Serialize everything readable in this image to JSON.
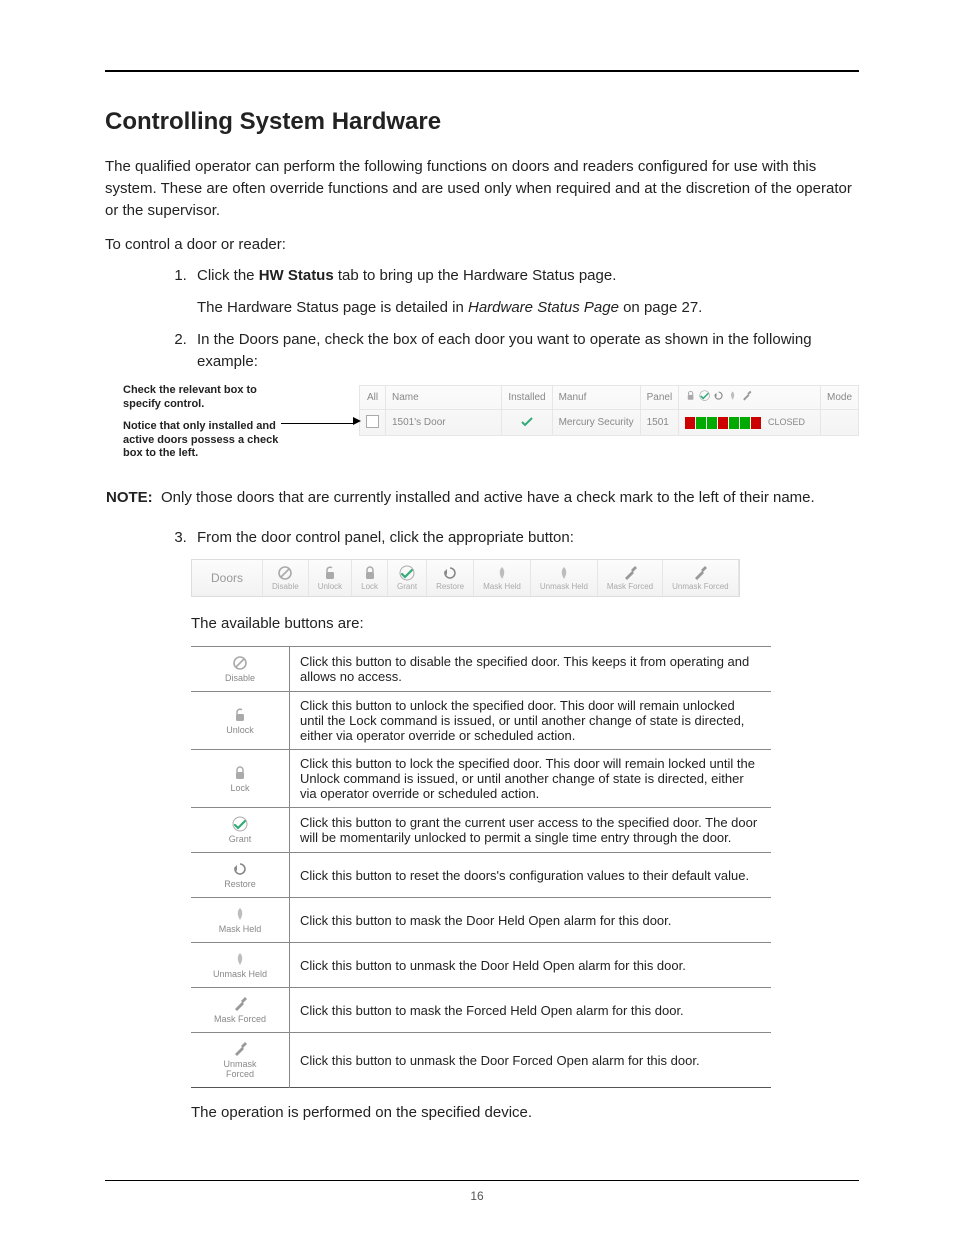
{
  "title": "Controlling System Hardware",
  "intro": "The qualified operator can perform the following functions on doors and readers configured for use with this system. These are often override functions and are used only when required and at the discretion of the operator or the supervisor.",
  "lead_in": "To control a door or reader:",
  "step1_pre": "Click the ",
  "step1_bold": "HW Status",
  "step1_post": " tab to bring up the Hardware Status page.",
  "step1_sub_pre": "The Hardware Status page is detailed in ",
  "step1_sub_em": "Hardware Status Page",
  "step1_sub_post": " on page 27.",
  "step2": "In the Doors pane, check the box of each door you want to operate as shown in the following example:",
  "callout1": "Check the relevant box to specify control.",
  "callout2": "Notice that only installed and active doors possess a check box to the left.",
  "doors_header": {
    "all": "All",
    "name": "Name",
    "installed": "Installed",
    "manuf": "Manuf",
    "panel": "Panel",
    "mode": "Mode"
  },
  "doors_row": {
    "name": "1501's Door",
    "manuf": "Mercury Security",
    "panel": "1501",
    "closed": "CLOSED"
  },
  "note_label": "NOTE:",
  "note_body": "Only those doors that are currently installed and active have a check mark to the left of their name.",
  "step3": "From the door control panel, click the appropriate button:",
  "panel_title": "Doors",
  "panel_buttons": [
    "Disable",
    "Unlock",
    "Lock",
    "Grant",
    "Restore",
    "Mask Held",
    "Unmask Held",
    "Mask Forced",
    "Unmask Forced"
  ],
  "available_text": "The available buttons are:",
  "buttons": [
    {
      "label": "Disable",
      "desc": "Click this button to disable the specified door. This keeps it from operating and allows no access."
    },
    {
      "label": "Unlock",
      "desc": "Click this button to unlock the specified door. This door will remain unlocked until the Lock command is issued, or until another change of state is directed, either via operator override or scheduled action."
    },
    {
      "label": "Lock",
      "desc": "Click this button to lock the specified door. This door will remain locked until the Unlock command is issued, or until another change of state is directed, either via operator override or scheduled action."
    },
    {
      "label": "Grant",
      "desc": "Click this button to grant the current user access to the specified door. The door will be momentarily unlocked to permit a single time entry through the door."
    },
    {
      "label": "Restore",
      "desc": "Click this button to reset the doors's configuration values to their default value."
    },
    {
      "label": "Mask Held",
      "desc": "Click this button to mask the Door Held Open alarm for this door."
    },
    {
      "label": "Unmask Held",
      "desc": "Click this button to unmask the Door Held Open alarm for this door."
    },
    {
      "label": "Mask Forced",
      "desc": "Click this button to mask the Forced Held Open alarm for this door."
    },
    {
      "label": "Unmask Forced",
      "desc": "Click this button to unmask the Door Forced Open alarm for this door."
    }
  ],
  "final": "The operation is performed on the specified device.",
  "page_number": "16"
}
